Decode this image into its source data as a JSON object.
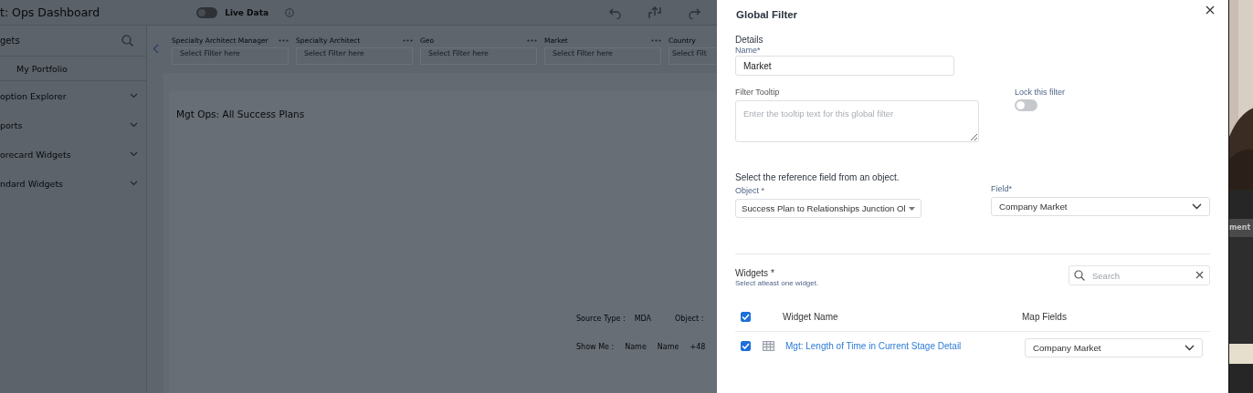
{
  "app": {
    "title": "t: Ops Dashboard",
    "live_data": {
      "label": "Live Data",
      "on": false
    },
    "sidebar": {
      "title": "gets",
      "items": [
        {
          "label": "My Portfolio",
          "kind": "link"
        },
        {
          "label": "option Explorer",
          "kind": "section",
          "expanded": false
        },
        {
          "label": "ports",
          "kind": "section",
          "expanded": false
        },
        {
          "label": "orecard Widgets",
          "kind": "section",
          "expanded": false
        },
        {
          "label": "ndard Widgets",
          "kind": "section",
          "expanded": false
        }
      ]
    },
    "filters": [
      {
        "label": "Specialty Architect Manager",
        "placeholder": "Select Filter here"
      },
      {
        "label": "Specialty Architect",
        "placeholder": "Select Filter here"
      },
      {
        "label": "Geo",
        "placeholder": "Select Filter here"
      },
      {
        "label": "Market",
        "placeholder": "Select Filter here"
      },
      {
        "label": "Country",
        "placeholder": "Select Filt"
      }
    ],
    "widget": {
      "title": "Mgt Ops: All Success Plans",
      "source_type_label": "Source Type :",
      "source_type": "MDA",
      "object_label": "Object :",
      "show_me_label": "Show Me :",
      "show_me": [
        "Name",
        "Name",
        "+48"
      ]
    }
  },
  "dialog": {
    "title": "Global Filter",
    "details_heading": "Details",
    "name_label": "Name*",
    "name_value": "Market",
    "tooltip_label": "Filter Tooltip",
    "tooltip_placeholder": "Enter the tooltip text for this global filter",
    "lock_label": "Lock this filter",
    "lock_on": false,
    "reference_heading": "Select the reference field from an object.",
    "object_label": "Object *",
    "object_value": "Success Plan to Relationships Junction Ol",
    "field_label": "Field*",
    "field_value": "Company Market",
    "widgets_heading": "Widgets *",
    "widgets_hint": "Select atleast one widget.",
    "search_placeholder": "Search",
    "table": {
      "all_checked": true,
      "columns": [
        "Widget Name",
        "Map Fields"
      ],
      "rows": [
        {
          "checked": true,
          "name": "Mgt: Length of Time in Current Stage Detail",
          "map_field": "Company Market"
        }
      ]
    }
  },
  "side_window": {
    "label": "ment"
  }
}
